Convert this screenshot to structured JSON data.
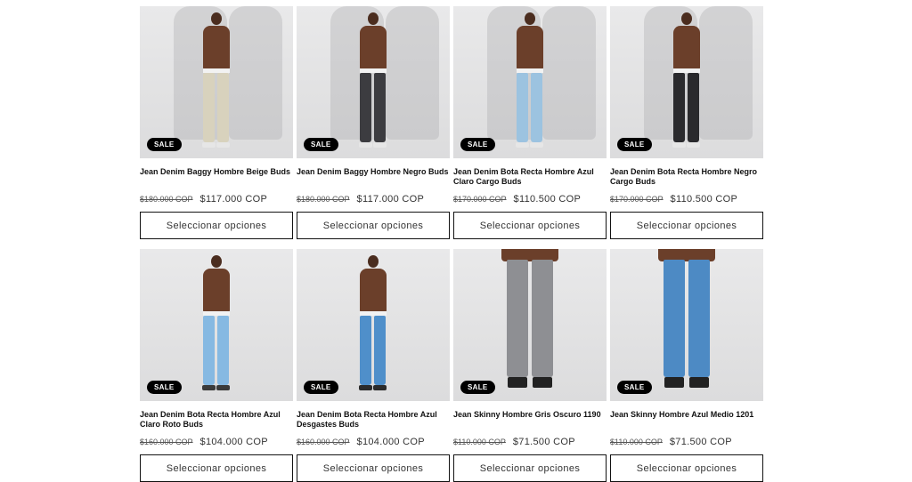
{
  "products": [
    {
      "title": "Jean Denim Baggy Hombre Beige Buds",
      "compare_price": "$180.000 COP",
      "price": "$117.000 COP",
      "badge": "SALE",
      "button_label": "Seleccionar opciones",
      "jean_color": "#d8d2bd",
      "shoe_color": "#e6e6e6",
      "ghost": true,
      "closeup": false
    },
    {
      "title": "Jean Denim Baggy Hombre Negro Buds",
      "compare_price": "$180.000 COP",
      "price": "$117.000 COP",
      "badge": "SALE",
      "button_label": "Seleccionar opciones",
      "jean_color": "#3c3c40",
      "shoe_color": "#e6e6e6",
      "ghost": true,
      "closeup": false
    },
    {
      "title": "Jean Denim Bota Recta Hombre Azul Claro Cargo Buds",
      "compare_price": "$170.000 COP",
      "price": "$110.500 COP",
      "badge": "SALE",
      "button_label": "Seleccionar opciones",
      "jean_color": "#9cc3e0",
      "shoe_color": "#e6e6e6",
      "ghost": true,
      "closeup": false
    },
    {
      "title": "Jean Denim Bota Recta Hombre Negro Cargo Buds",
      "compare_price": "$170.000 COP",
      "price": "$110.500 COP",
      "badge": "SALE",
      "button_label": "Seleccionar opciones",
      "jean_color": "#2a2a2d",
      "shoe_color": "#e6e6e6",
      "ghost": true,
      "closeup": false
    },
    {
      "title": "Jean Denim Bota Recta Hombre Azul Claro Roto Buds",
      "compare_price": "$160.000 COP",
      "price": "$104.000 COP",
      "badge": "SALE",
      "button_label": "Seleccionar opciones",
      "jean_color": "#86b9e2",
      "shoe_color": "#3a3a3a",
      "ghost": false,
      "closeup": false
    },
    {
      "title": "Jean Denim Bota Recta Hombre Azul Desgastes Buds",
      "compare_price": "$160.000 COP",
      "price": "$104.000 COP",
      "badge": "SALE",
      "button_label": "Seleccionar opciones",
      "jean_color": "#4f8fca",
      "shoe_color": "#2b2b2b",
      "ghost": false,
      "closeup": false
    },
    {
      "title": "Jean Skinny Hombre Gris Oscuro 1190",
      "compare_price": "$110.000 COP",
      "price": "$71.500 COP",
      "badge": "SALE",
      "button_label": "Seleccionar opciones",
      "jean_color": "#8e8f93",
      "shoe_color": "#222222",
      "ghost": false,
      "closeup": true
    },
    {
      "title": "Jean Skinny Hombre Azul Medio 1201",
      "compare_price": "$110.000 COP",
      "price": "$71.500 COP",
      "badge": "SALE",
      "button_label": "Seleccionar opciones",
      "jean_color": "#4d8ac4",
      "shoe_color": "#222222",
      "ghost": false,
      "closeup": true
    }
  ]
}
